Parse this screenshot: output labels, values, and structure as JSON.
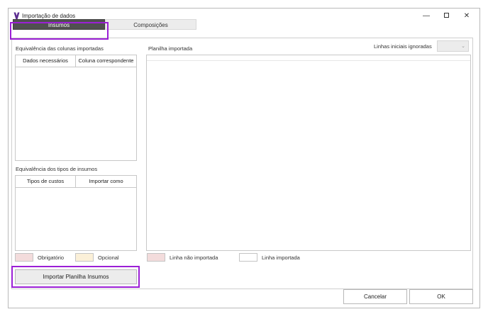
{
  "window": {
    "title": "Importação de dados",
    "accent": "#5c2d91"
  },
  "tabs": [
    {
      "label": "Insumos",
      "active": true
    },
    {
      "label": "Composições",
      "active": false
    }
  ],
  "left": {
    "colunas_label": "Equivalência das colunas importadas",
    "colunas_headers": [
      "Dados necessários",
      "Coluna correspondente"
    ],
    "tipos_label": "Equivalência dos tipos de insumos",
    "tipos_headers": [
      "Tipos de custos",
      "Importar como"
    ]
  },
  "right": {
    "planilha_label": "Planilha importada",
    "linhas_label": "Linhas iniciais ignoradas",
    "linhas_value": ""
  },
  "legend": {
    "obrigatorio": "Obrigatório",
    "opcional": "Opcional",
    "linha_nao_importada": "Linha não importada",
    "linha_importada": "Linha importada",
    "colors": {
      "obrigatorio": "#f3dcdc",
      "opcional": "#fbf0d8",
      "linha_nao_importada": "#f3dcdc",
      "linha_importada": "#ffffff"
    }
  },
  "buttons": {
    "importar": "Importar Planilha Insumos",
    "cancelar": "Cancelar",
    "ok": "OK"
  },
  "highlight_color": "#9b1fd6",
  "icons": {
    "app": "app-logo-icon",
    "minimize": "minimize-icon",
    "maximize": "maximize-icon",
    "close": "close-icon",
    "dropdown": "chevron-down-icon"
  }
}
